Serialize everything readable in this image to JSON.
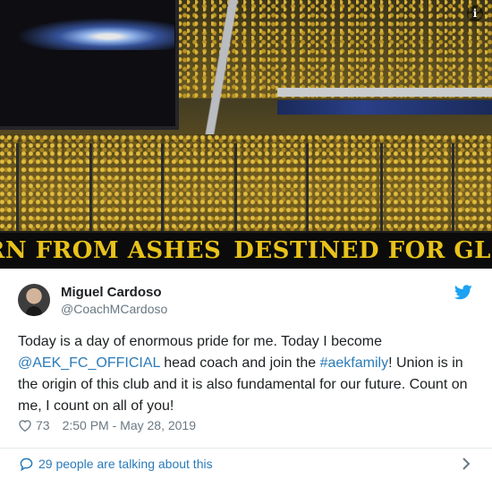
{
  "photo": {
    "banner_left": "BORN FROM ASHES",
    "banner_right": "DESTINED FOR GLORY",
    "info_icon": "i",
    "icons": [
      "info-icon",
      "eagle-emblem"
    ]
  },
  "tweet": {
    "author": {
      "display_name": "Miguel Cardoso",
      "handle": "@CoachMCardoso"
    },
    "text": {
      "p1": "Today is a day of enormous pride for me. Today I become ",
      "mention": "@AEK_FC_OFFICIAL",
      "p2": " head coach and join the ",
      "hashtag": "#aekfamily",
      "p3": "! Union is in the origin of this club and it is also fundamental for our future. Count on me, I count on all of you!"
    },
    "likes": "73",
    "timestamp": "2:50 PM - May 28, 2019",
    "talking": "29 people are talking about this",
    "icons": [
      "twitter-bird-icon",
      "heart-icon",
      "speech-bubble-icon",
      "chevron-right-icon"
    ]
  },
  "colors": {
    "link": "#2b7bb9",
    "text": "#1c2022",
    "muted": "#697882",
    "banner_text": "#e8c21a",
    "twitter_blue": "#1da1f2"
  }
}
